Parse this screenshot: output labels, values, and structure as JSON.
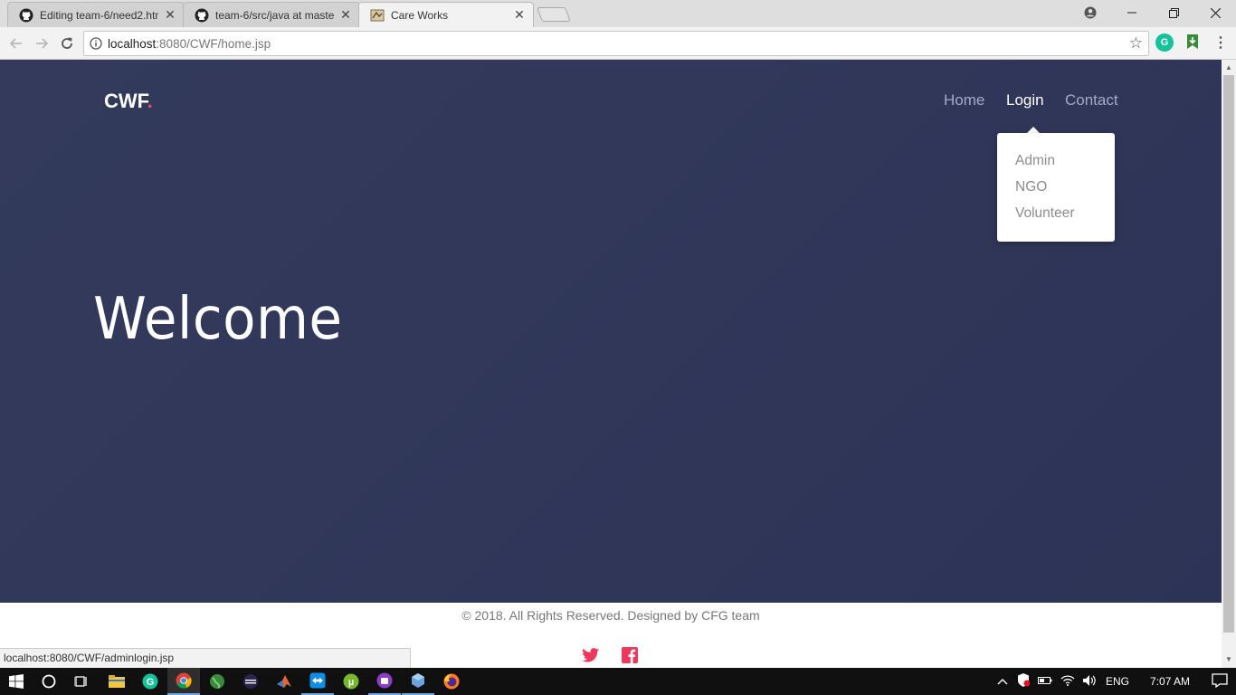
{
  "browser": {
    "tabs": [
      {
        "title": "Editing team-6/need2.htm",
        "icon": "github-icon"
      },
      {
        "title": "team-6/src/java at maste",
        "icon": "github-icon"
      },
      {
        "title": "Care Works",
        "icon": "page-icon"
      }
    ],
    "active_tab": 2,
    "url_host": "localhost",
    "url_rest": ":8080/CWF/home.jsp",
    "status_url": "localhost:8080/CWF/adminlogin.jsp"
  },
  "site": {
    "logo": "CWF",
    "logo_dot": ".",
    "nav": {
      "home": "Home",
      "login": "Login",
      "contact": "Contact"
    },
    "dropdown": [
      "Admin",
      "NGO",
      "Volunteer"
    ],
    "hero_title": "Welcome",
    "footer": "© 2018. All Rights Reserved. Designed by CFG team",
    "accent_color": "#f05060",
    "hero_color": "#31385a"
  },
  "taskbar": {
    "time": "7:07 AM",
    "lang": "ENG"
  }
}
